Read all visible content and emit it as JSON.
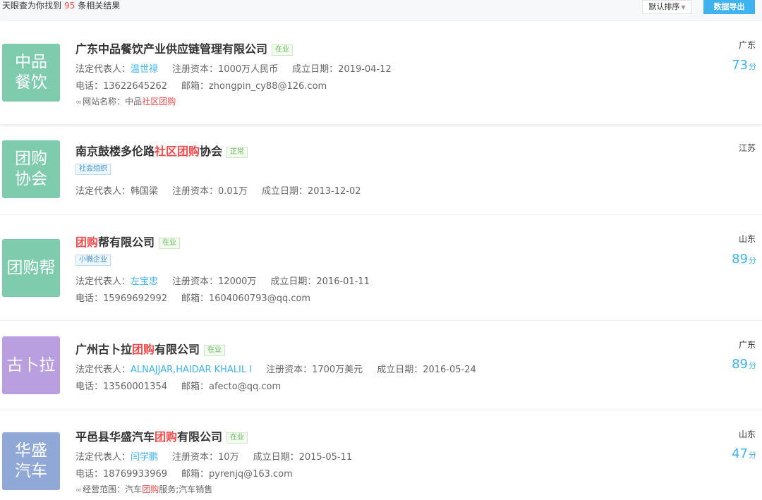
{
  "summary": {
    "prefix": "天眼查为你找到",
    "count": "95",
    "suffix": "条相关结果"
  },
  "toolbar": {
    "sort_label": "默认排序",
    "export_label": "数据导出"
  },
  "results": [
    {
      "logo_lines": [
        "中品",
        "餐饮"
      ],
      "logo_color": "#7ecbae",
      "title_parts": [
        "广东中品餐饮产业供应链管理有限公司"
      ],
      "status": "在业",
      "legal_label": "法定代表人：",
      "legal_value": "温世禄",
      "capital": "注册资本：1000万人民币",
      "founded": "成立日期：2019-04-12",
      "phone": "电话：13622645262",
      "email": "邮箱：zhongpin_cy88@126.com",
      "extra_label": "网站名称：中品",
      "extra_hl": "社区团购",
      "region": "广东",
      "score": "73",
      "score_unit": "分"
    },
    {
      "logo_lines": [
        "团购",
        "协会"
      ],
      "logo_color": "#7ecbae",
      "title_parts": [
        "南京鼓楼多伦路",
        "社区团购",
        "协会"
      ],
      "status": "正常",
      "tag": "社会组织",
      "legal_label": "法定代表人：",
      "legal_value": "韩国梁",
      "capital": "注册资本：0.01万",
      "founded": "成立日期：2013-12-02",
      "region": "江苏"
    },
    {
      "logo_lines": [
        "团购帮"
      ],
      "logo_color": "#7ecbae",
      "title_parts": [
        "团购",
        "帮有限公司"
      ],
      "status": "在业",
      "tag": "小微企业",
      "legal_label": "法定代表人：",
      "legal_value": "左宝忠",
      "capital": "注册资本：12000万",
      "founded": "成立日期：2016-01-11",
      "phone": "电话：15969692992",
      "email": "邮箱：1604060793@qq.com",
      "region": "山东",
      "score": "89",
      "score_unit": "分"
    },
    {
      "logo_lines": [
        "古卜拉"
      ],
      "logo_color": "#b99ee0",
      "title_parts": [
        "广州古卜拉",
        "团购",
        "有限公司"
      ],
      "status": "在业",
      "legal_label": "法定代表人：",
      "legal_value": "ALNAJJAR,HAIDAR KHALIL I",
      "capital": "注册资本：1700万美元",
      "founded": "成立日期：2016-05-24",
      "phone": "电话：13560001354",
      "email": "邮箱：afecto@qq.com",
      "region": "广东",
      "score": "89",
      "score_unit": "分"
    },
    {
      "logo_lines": [
        "华盛",
        "汽车"
      ],
      "logo_color": "#8fa8d6",
      "title_parts": [
        "平邑县华盛汽车",
        "团购",
        "有限公司"
      ],
      "status": "在业",
      "legal_label": "法定代表人：",
      "legal_value": "闫学鹏",
      "capital": "注册资本：10万",
      "founded": "成立日期：2015-05-11",
      "phone": "电话：18769933969",
      "email": "邮箱：pyrenjq@163.com",
      "extra_label": "经营范围：汽车",
      "extra_hl": "团购",
      "extra_tail": "服务;汽车销售",
      "region": "山东",
      "score": "47",
      "score_unit": "分"
    }
  ]
}
